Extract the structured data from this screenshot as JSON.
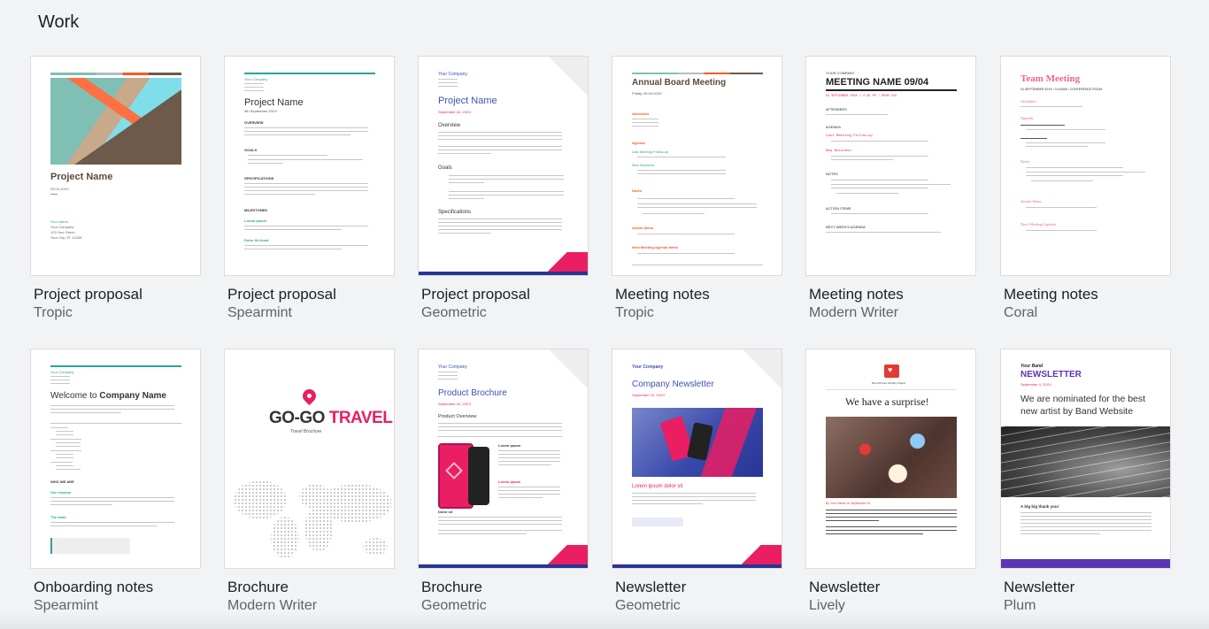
{
  "section": {
    "title": "Work"
  },
  "templates": [
    {
      "name": "Project proposal",
      "style": "Tropic",
      "doc": {
        "title": "Project Name",
        "date": "09.04.20XX",
        "footer_name": "Your Name",
        "footer_lines": [
          "Your Company",
          "123 Your Street",
          "Your City, ST 12345"
        ]
      }
    },
    {
      "name": "Project proposal",
      "style": "Spearmint",
      "doc": {
        "company": "Your Company",
        "title": "Project Name",
        "date": "4th September 20XX",
        "headings": [
          "OVERVIEW",
          "GOALS",
          "SPECIFICATIONS",
          "MILESTONES"
        ],
        "sub1": "Lorem Ipsum",
        "sub2": "Dolor Sit Amet"
      }
    },
    {
      "name": "Project proposal",
      "style": "Geometric",
      "doc": {
        "company": "Your Company",
        "title": "Project Name",
        "date": "September 04, 20XX",
        "headings": [
          "Overview",
          "Goals",
          "Specifications"
        ]
      }
    },
    {
      "name": "Meeting notes",
      "style": "Tropic",
      "doc": {
        "title": "Annual Board Meeting",
        "date": "Friday, 09.04.20XX",
        "headings": [
          "Attendees",
          "Agenda",
          "Last Meeting Follow-up",
          "New Business",
          "Notes",
          "Action Items",
          "Next Meeting Agenda Items"
        ]
      }
    },
    {
      "name": "Meeting notes",
      "style": "Modern Writer",
      "doc": {
        "company": "YOUR COMPANY",
        "title": "MEETING NAME 09/04",
        "meta": "04 SEPTEMBER 20XX / 4:30 PM / ROOM 234",
        "headings": [
          "ATTENDEES",
          "AGENDA",
          "NOTES",
          "ACTION ITEMS",
          "NEXT WEEK'S AGENDA"
        ],
        "sub1": "Last Meeting Follow-up",
        "sub2": "New Business"
      }
    },
    {
      "name": "Meeting notes",
      "style": "Coral",
      "doc": {
        "title": "Team Meeting",
        "meta": "04 SEPTEMBER 20XX / 10:00AM / CONFERENCE ROOM",
        "headings": [
          "Attendees",
          "Agenda",
          "Notes",
          "Action Items",
          "Next Meeting Agenda"
        ]
      }
    },
    {
      "name": "Onboarding notes",
      "style": "Spearmint",
      "doc": {
        "company": "Your Company",
        "title_prefix": "Welcome to ",
        "title_bold": "Company Name",
        "headings": [
          "WHO WE ARE"
        ],
        "sub1": "Our mission",
        "sub2": "The team"
      }
    },
    {
      "name": "Brochure",
      "style": "Modern Writer",
      "doc": {
        "title_a": "GO-GO ",
        "title_b": "TRAVEL",
        "subtitle": "Travel Brochure"
      }
    },
    {
      "name": "Brochure",
      "style": "Geometric",
      "doc": {
        "company": "Your Company",
        "title": "Product Brochure",
        "date": "September 04, 20XX",
        "heading": "Product Overview",
        "sub1": "Lorem ipsum",
        "sub2": "Lorem ipsum",
        "sub3": "Dolor sit"
      }
    },
    {
      "name": "Newsletter",
      "style": "Geometric",
      "doc": {
        "company": "Your Company",
        "title": "Company Newsletter",
        "date": "September 04, 20XX",
        "heading": "Lorem ipsum dolor sit"
      }
    },
    {
      "name": "Newsletter",
      "style": "Lively",
      "doc": {
        "masthead": "HeartWorks Weekly Digest",
        "title": "We have a surprise!",
        "byline": "By Your Name on September 04"
      }
    },
    {
      "name": "Newsletter",
      "style": "Plum",
      "doc": {
        "band": "Your Band",
        "title": "NEWSLETTER",
        "date": "September 4, 20XX",
        "headline": "We are nominated for the best new artist by Band Website",
        "sub": "A big big thank you!"
      }
    }
  ],
  "colors": {
    "spearmint": "#26a69a",
    "geometric": "#3f51b5",
    "coral": "#f06292",
    "tropic_orange": "#ff5722",
    "plum": "#5e35b1",
    "pink": "#e91e63"
  }
}
